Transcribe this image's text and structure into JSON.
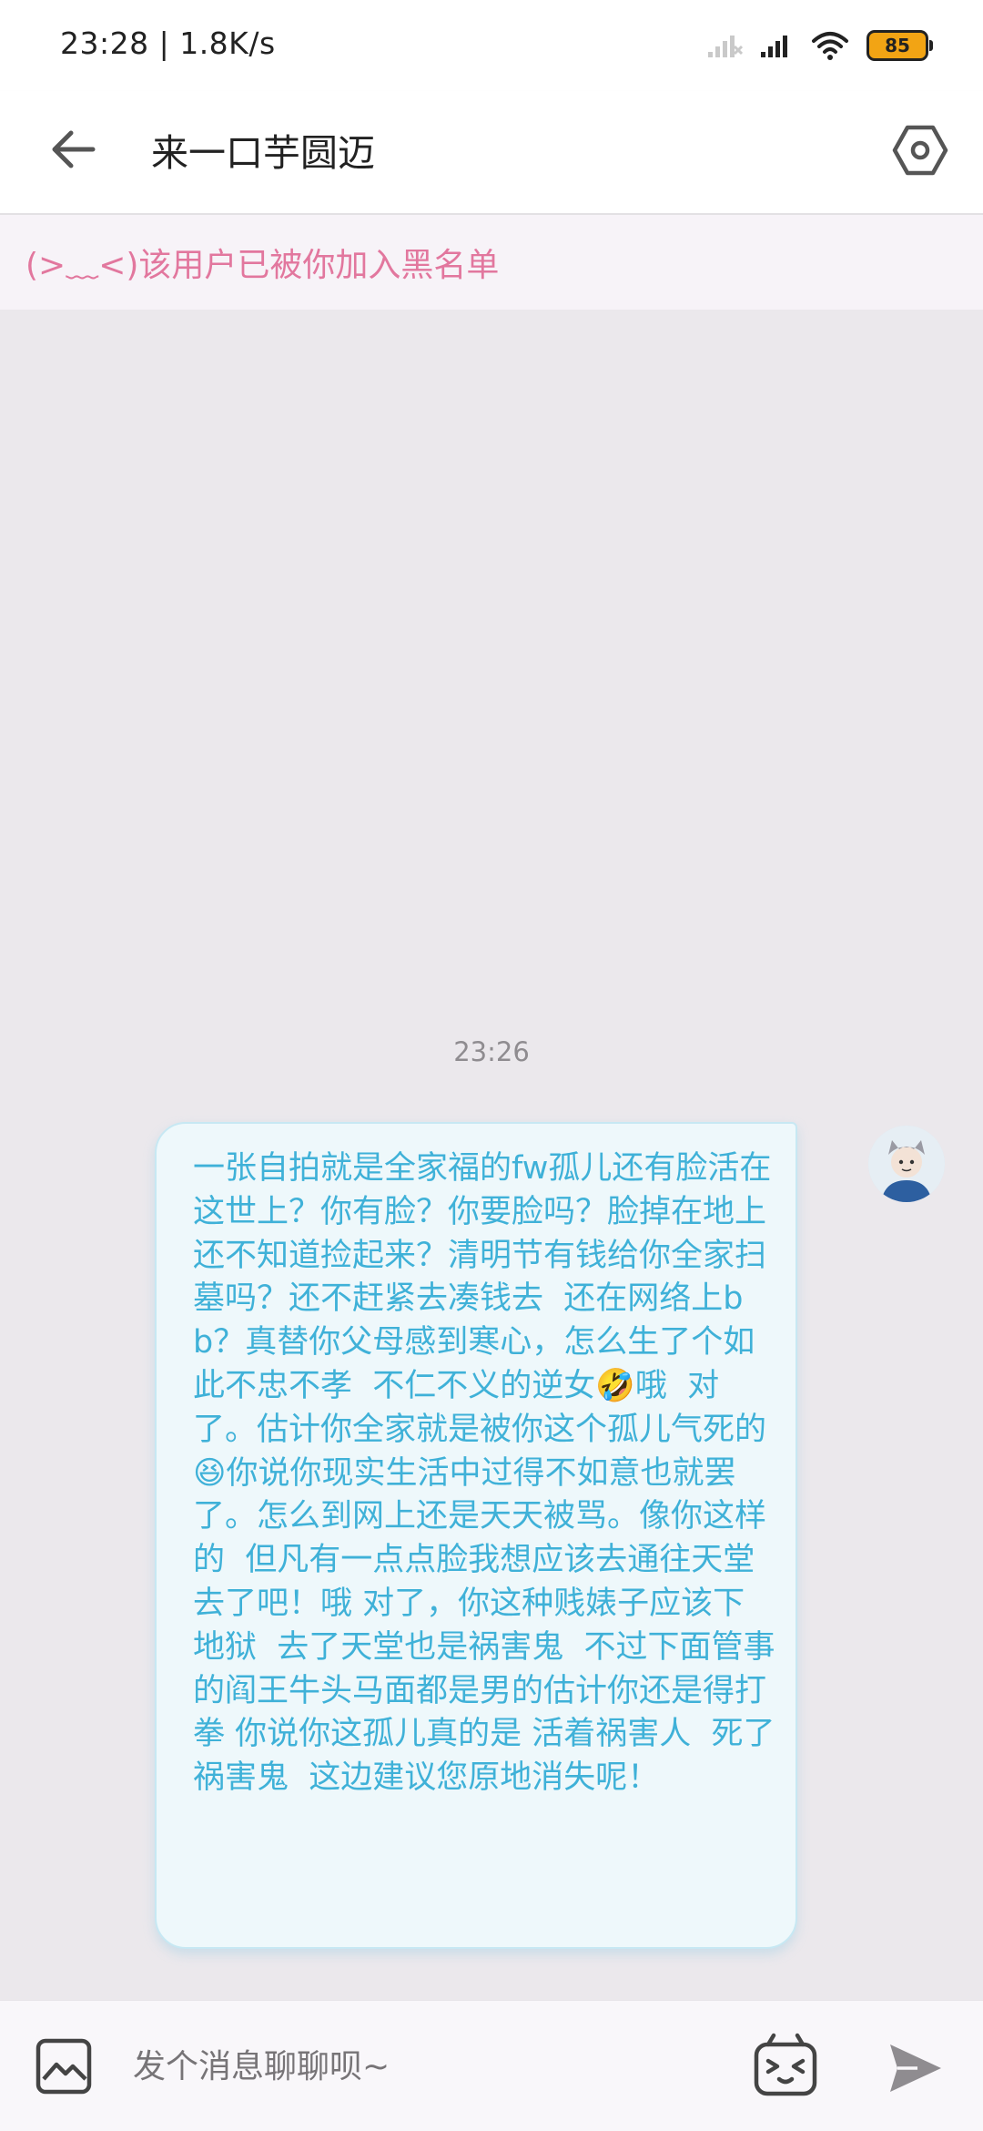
{
  "status_bar": {
    "time_speed": "23:28 | 1.8K/s",
    "battery": "85",
    "icons": [
      "signal-empty-icon",
      "signal-icon",
      "wifi-icon",
      "battery-icon"
    ]
  },
  "header": {
    "title": "来一口芋圆迈",
    "icons": [
      "back-arrow-icon",
      "settings-hexagon-icon"
    ]
  },
  "notice": {
    "text": "(>﹏<)该用户已被你加入黑名单",
    "color": "#e2779e"
  },
  "conversation": {
    "time": "23:26",
    "messages": [
      {
        "from": "self",
        "text": "一张自拍就是全家福的fw孤儿还有脸活在这世上？你有脸？你要脸吗？脸掉在地上还不知道捡起来？清明节有钱给你全家扫墓吗？还不赶紧去凑钱去  还在网络上bb？真替你父母感到寒心，怎么生了个如此不忠不孝  不仁不义的逆女🤣哦  对了。估计你全家就是被你这个孤儿气死的😆你说你现实生活中过得不如意也就罢了。怎么到网上还是天天被骂。像你这样的  但凡有一点点脸我想应该去通往天堂去了吧！哦 对了，你这种贱婊子应该下地狱  去了天堂也是祸害鬼  不过下面管事的阎王牛头马面都是男的估计你还是得打拳 你说你这孤儿真的是 活着祸害人  死了祸害鬼  这边建议您原地消失呢！",
        "text_color": "#3fb1d8",
        "bubble_color": "#eef8fb"
      }
    ]
  },
  "input_bar": {
    "placeholder": "发个消息聊聊呗~",
    "icons": [
      "image-icon",
      "emoji-face-icon",
      "send-icon"
    ]
  }
}
